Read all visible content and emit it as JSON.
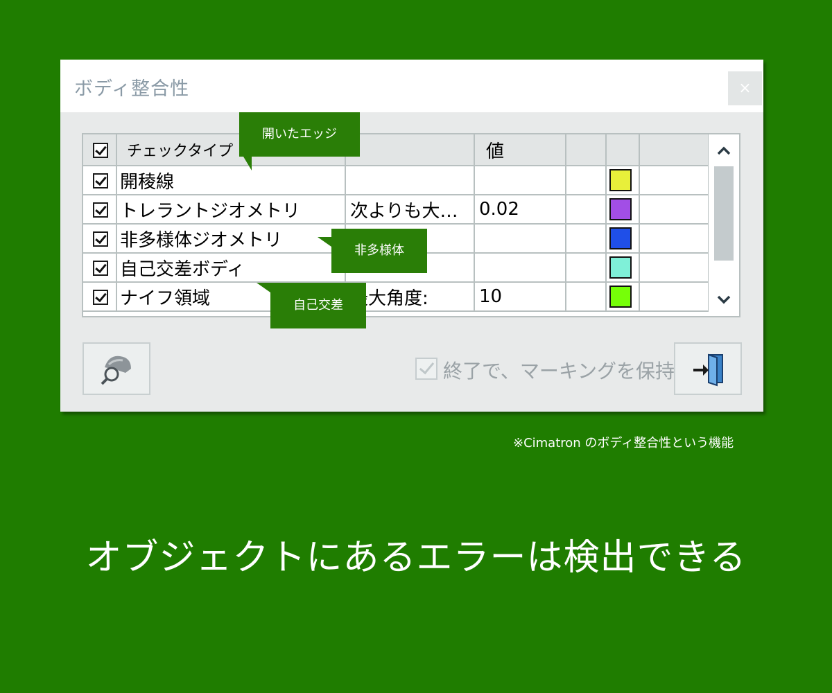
{
  "dialog": {
    "title": "ボディ整合性",
    "close_label": "×"
  },
  "grid": {
    "headers": [
      "チェックタイプ",
      "",
      "値",
      "",
      "",
      ""
    ],
    "rows": [
      {
        "checked": true,
        "type": "開稜線",
        "cond": "",
        "value": "",
        "color": "#e8ef3a"
      },
      {
        "checked": true,
        "type": "トレラントジオメトリ",
        "cond": "次よりも大…",
        "value": "0.02",
        "color": "#a24ee6"
      },
      {
        "checked": true,
        "type": "非多様体ジオメトリ",
        "cond": "",
        "value": "",
        "color": "#1f4fe8"
      },
      {
        "checked": true,
        "type": "自己交差ボディ",
        "cond": "",
        "value": "",
        "color": "#7ff0d8"
      },
      {
        "checked": true,
        "type": "ナイフ領域",
        "cond": "最大角度:",
        "value": "10",
        "color": "#76ff08"
      }
    ]
  },
  "scrollbar": {
    "up_icon": "chevron-up-icon",
    "down_icon": "chevron-down-icon"
  },
  "tooltips": {
    "open_edge": "開いたエッジ",
    "non_manifold": "非多様体",
    "self_intersect": "自己交差"
  },
  "bottom": {
    "keep_marking_label": "終了で、マーキングを保持",
    "keep_marking_checked": true,
    "inspect_icon": "magnifier-body-icon",
    "exit_icon": "exit-door-icon"
  },
  "footnote": "※Cimatron のボディ整合性という機能",
  "headline": "オブジェクトにあるエラーは検出できる",
  "colors": {
    "background": "#1f7d00",
    "tooltip": "#2a7e07",
    "dialog": "#e8eaea"
  }
}
